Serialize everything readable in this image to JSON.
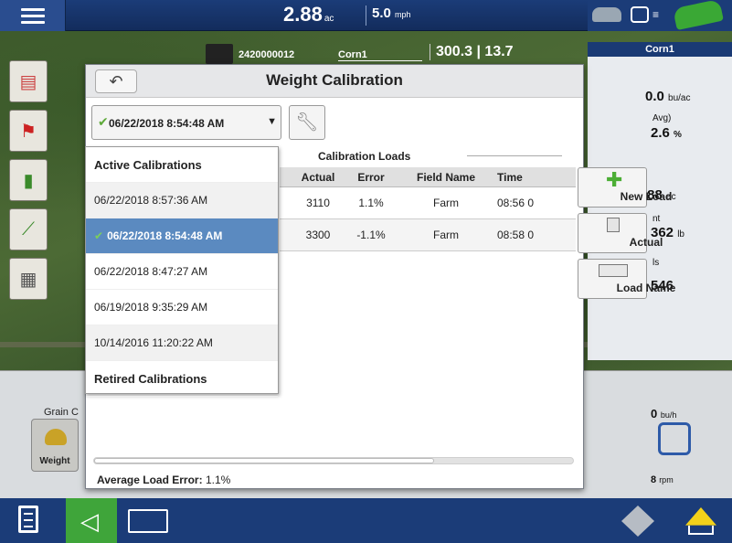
{
  "topbar": {
    "area_value": "2.88",
    "area_unit": "ac",
    "speed_value": "5.0",
    "speed_unit": "mph"
  },
  "vehicle": {
    "id": "2420000012",
    "field": "Corn1",
    "value_1": "300.3",
    "value_2": "13.7"
  },
  "right_panel": {
    "title": "Corn1",
    "yield_value": "0.0",
    "yield_unit": "bu/ac",
    "avg_label": "Avg)",
    "moisture_value": "2.6",
    "moisture_unit": "%",
    "area_value": ".88",
    "area_unit": "ac",
    "weight_label": "nt",
    "weight_value": "362",
    "weight_unit": "lb",
    "loads_label": "ls",
    "loads_value": "546",
    "flow_value": "0",
    "flow_unit": "bu/h",
    "rpm_value": "8",
    "rpm_unit": "rpm"
  },
  "grain": {
    "label": "Grain C",
    "weight_button": "Weight"
  },
  "dialog": {
    "title": "Weight Calibration",
    "selected_calibration": "06/22/2018 8:54:48 AM",
    "loads_title": "Calibration Loads",
    "columns": [
      "Actual",
      "Error",
      "Field Name",
      "Time"
    ],
    "rows": [
      {
        "actual": "3110",
        "error": "1.1%",
        "field": "Farm",
        "time": "08:56 0"
      },
      {
        "actual": "3300",
        "error": "-1.1%",
        "field": "Farm",
        "time": "08:58 0"
      }
    ],
    "buttons": {
      "new_load": "New Load",
      "actual": "Actual",
      "load_name": "Load Name"
    },
    "average_label": "Average Load Error:",
    "average_value": "1.1%"
  },
  "dropdown": {
    "active_heading": "Active Calibrations",
    "items": [
      "06/22/2018 8:57:36 AM",
      "06/22/2018 8:54:48 AM",
      "06/22/2018 8:47:27 AM",
      "06/19/2018 9:35:29 AM",
      "10/14/2016 11:20:22 AM"
    ],
    "retired_heading": "Retired Calibrations"
  },
  "colors": {
    "nav_blue": "#1b3c78",
    "accent_green": "#3fa53a",
    "selected_row": "#5b8ac0"
  }
}
